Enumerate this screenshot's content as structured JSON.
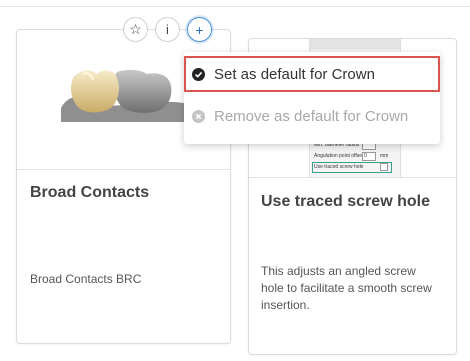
{
  "header": {
    "star_button": "☆",
    "info_button": "i",
    "add_button": "+"
  },
  "menu": {
    "items": [
      {
        "label": "Set as default for Crown",
        "icon": "check-circle-icon",
        "enabled": true
      },
      {
        "label": "Remove as default for Crown",
        "icon": "x-circle-icon",
        "enabled": false
      }
    ]
  },
  "cards": [
    {
      "title": "Broad Contacts",
      "description": "Broad Contacts BRC",
      "image": "dental-crowns-3d-render"
    },
    {
      "title": "Use traced screw hole",
      "description": "This adjusts an angled screw hole to facilitate a smooth screw insertion.",
      "image": "settings-dialog-screenshot",
      "thumb_rows": [
        "Min. diameter radius",
        "Angulation point offset",
        "Use traced screw hole"
      ],
      "thumb_values": [
        "0",
        "0"
      ],
      "thumb_unit": "mm"
    }
  ],
  "colors": {
    "highlight_border": "#d9534f",
    "active_button_border": "#4a90d9",
    "thumb_highlight": "#3aa08a"
  }
}
